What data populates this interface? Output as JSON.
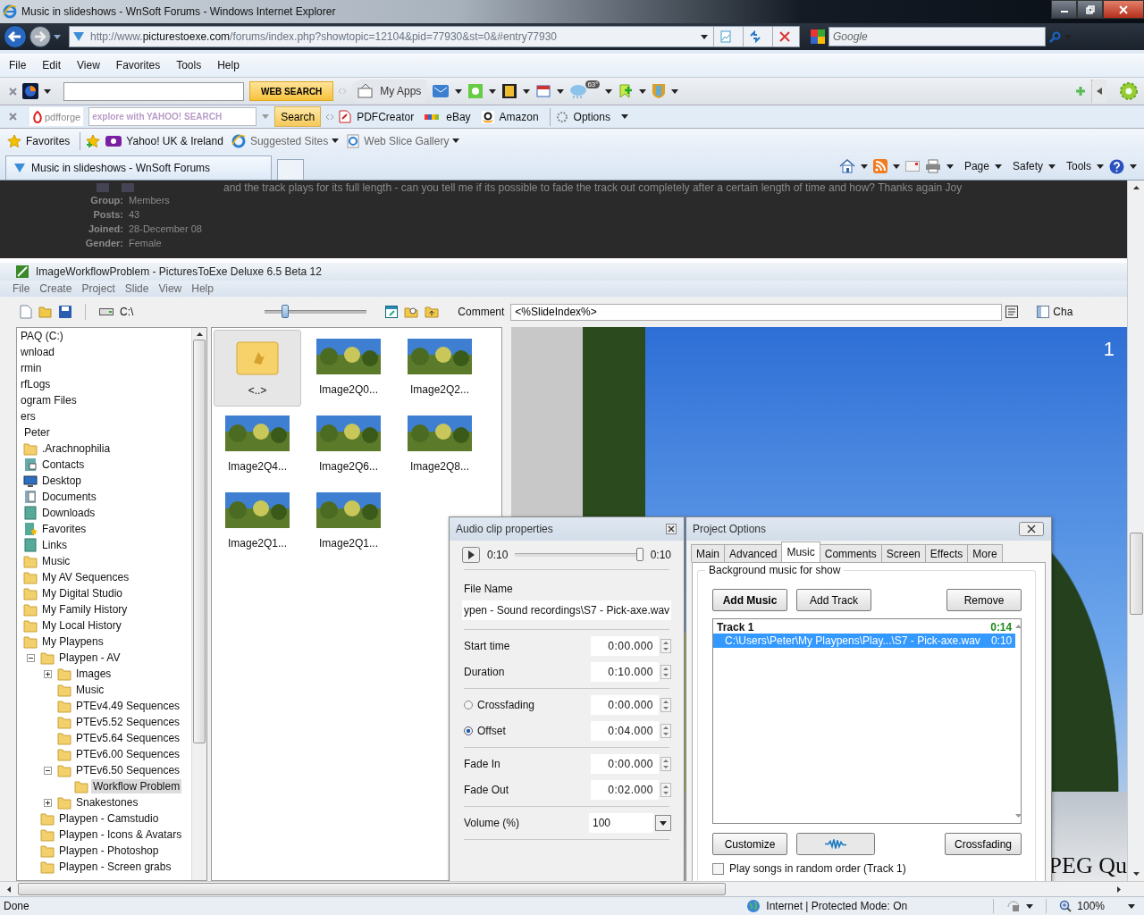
{
  "browser": {
    "title": "Music in slideshows - WnSoft Forums - Windows Internet Explorer",
    "address_host": "http://www.",
    "address_domain": "picturestoexe.com",
    "address_path": "/forums/index.php?showtopic=12104&pid=77930&st=0&#entry77930",
    "search_placeholder": "Google",
    "menu": [
      "File",
      "Edit",
      "View",
      "Favorites",
      "Tools",
      "Help"
    ],
    "toolbar": {
      "search_button": "WEB SEARCH",
      "apps_button": "My Apps",
      "weather_badge": "63°"
    },
    "toolbar2": {
      "brand": "pdfforge",
      "search_placeholder": "explore with YAHOO! SEARCH",
      "search_button": "Search",
      "links": [
        "PDFCreator",
        "eBay",
        "Amazon"
      ],
      "options": "Options"
    },
    "favorites": {
      "label": "Favorites",
      "links": [
        {
          "label": "Yahoo! UK & Ireland",
          "menu": false
        },
        {
          "label": "Suggested Sites",
          "menu": true
        },
        {
          "label": "Web Slice Gallery",
          "menu": true
        }
      ]
    },
    "tab": "Music in slideshows - WnSoft Forums",
    "commands": [
      "Page",
      "Safety",
      "Tools"
    ]
  },
  "forum": {
    "post_text": "and the track plays for its full length - can you tell me if its possible to fade the track out completely after a certain length of time and how? Thanks again Joy",
    "profile": [
      {
        "label": "Group:",
        "value": "Members"
      },
      {
        "label": "Posts:",
        "value": "43"
      },
      {
        "label": "Joined:",
        "value": "28-December 08"
      },
      {
        "label": "Gender:",
        "value": "Female"
      }
    ]
  },
  "app": {
    "title": "ImageWorkflowProblem - PicturesToExe Deluxe 6.5 Beta 12",
    "menu": [
      "File",
      "Create",
      "Project",
      "Slide",
      "View",
      "Help"
    ],
    "drive": "C:\\",
    "zoom_slider": {
      "level": 0.2
    },
    "comment_label": "Comment",
    "comment_value": "<%SlideIndex%>",
    "cut_label": "Cha",
    "tree": [
      {
        "label": "PAQ (C:)",
        "selected": false,
        "children": [
          {
            "label": "wnload",
            "selected": false
          },
          {
            "label": "rmin",
            "selected": false
          },
          {
            "label": "rfLogs",
            "selected": false
          },
          {
            "label": "ogram Files",
            "selected": false
          },
          {
            "label": "ers",
            "selected": false,
            "children": [
              {
                "label": "Peter",
                "selected": false,
                "children": [
                  {
                    "label": ".Arachnophilia",
                    "kind": "folder",
                    "selected": false
                  },
                  {
                    "label": "Contacts",
                    "kind": "contacts",
                    "selected": false
                  },
                  {
                    "label": "Desktop",
                    "kind": "desktop",
                    "selected": false
                  },
                  {
                    "label": "Documents",
                    "kind": "documents",
                    "selected": false
                  },
                  {
                    "label": "Downloads",
                    "kind": "special",
                    "selected": false
                  },
                  {
                    "label": "Favorites",
                    "kind": "favorites",
                    "selected": false
                  },
                  {
                    "label": "Links",
                    "kind": "special",
                    "selected": false
                  },
                  {
                    "label": "Music",
                    "kind": "folder",
                    "selected": false
                  },
                  {
                    "label": "My AV Sequences",
                    "kind": "folder",
                    "selected": false
                  },
                  {
                    "label": "My Digital Studio",
                    "kind": "folder",
                    "selected": false
                  },
                  {
                    "label": "My Family History",
                    "kind": "folder",
                    "selected": false
                  },
                  {
                    "label": "My Local History",
                    "kind": "folder",
                    "selected": false
                  },
                  {
                    "label": "My Playpens",
                    "kind": "folder",
                    "selected": false,
                    "children": [
                      {
                        "label": "Playpen - AV",
                        "kind": "folder",
                        "selected": false,
                        "expanded": true,
                        "children": [
                          {
                            "label": "Images",
                            "kind": "folder",
                            "selected": false,
                            "expanded": false
                          },
                          {
                            "label": "Music",
                            "kind": "folder",
                            "selected": false
                          },
                          {
                            "label": "PTEv4.49 Sequences",
                            "kind": "folder",
                            "selected": false
                          },
                          {
                            "label": "PTEv5.52 Sequences",
                            "kind": "folder",
                            "selected": false
                          },
                          {
                            "label": "PTEv5.64 Sequences",
                            "kind": "folder",
                            "selected": false
                          },
                          {
                            "label": "PTEv6.00 Sequences",
                            "kind": "folder",
                            "selected": false
                          },
                          {
                            "label": "PTEv6.50 Sequences",
                            "kind": "folder",
                            "selected": false,
                            "expanded": true,
                            "children": [
                              {
                                "label": "Workflow Problem",
                                "kind": "folder",
                                "selected": true
                              }
                            ]
                          },
                          {
                            "label": "Snakestones",
                            "kind": "folder",
                            "selected": false,
                            "expanded": false
                          }
                        ]
                      },
                      {
                        "label": "Playpen - Camstudio",
                        "kind": "folder",
                        "selected": false
                      },
                      {
                        "label": "Playpen - Icons & Avatars",
                        "kind": "folder",
                        "selected": false
                      },
                      {
                        "label": "Playpen - Photoshop",
                        "kind": "folder",
                        "selected": false
                      },
                      {
                        "label": "Playpen - Screen grabs",
                        "kind": "folder",
                        "selected": false
                      }
                    ]
                  }
                ]
              }
            ]
          }
        ]
      }
    ],
    "thumbnails": [
      {
        "label": "<..>",
        "kind": "folder",
        "selected": true
      },
      {
        "label": "Image2Q0...",
        "kind": "image",
        "selected": false
      },
      {
        "label": "Image2Q2...",
        "kind": "image",
        "selected": false
      },
      {
        "label": "Image2Q4...",
        "kind": "image",
        "selected": false
      },
      {
        "label": "Image2Q6...",
        "kind": "image",
        "selected": false
      },
      {
        "label": "Image2Q8...",
        "kind": "image",
        "selected": false
      },
      {
        "label": "Image2Q1...",
        "kind": "image",
        "selected": false
      },
      {
        "label": "Image2Q1...",
        "kind": "image",
        "selected": false
      }
    ],
    "slide_number": "1",
    "slide_caption": "PEG Qu"
  },
  "audio_clip": {
    "title": "Audio clip properties",
    "position": "0:10",
    "length": "0:10",
    "seek": {
      "level": 1
    },
    "file_label": "File Name",
    "file_value": "ypen - Sound recordings\\S7 - Pick-axe.wav",
    "groups": [
      [
        {
          "kind": "spin",
          "label": "Start time",
          "value": "0:00.000"
        },
        {
          "kind": "spin",
          "label": "Duration",
          "value": "0:10.000"
        }
      ],
      [
        {
          "kind": "radio",
          "label": "Crossfading",
          "value": "0:00.000",
          "selected": false
        },
        {
          "kind": "radio",
          "label": "Offset",
          "value": "0:04.000",
          "selected": true
        }
      ],
      [
        {
          "kind": "spin",
          "label": "Fade In",
          "value": "0:00.000"
        },
        {
          "kind": "spin",
          "label": "Fade Out",
          "value": "0:02.000"
        }
      ],
      [
        {
          "kind": "dropdown",
          "label": "Volume (%)",
          "value": "100"
        }
      ]
    ]
  },
  "project_options": {
    "title": "Project Options",
    "tabs": [
      {
        "label": "Main",
        "selected": false
      },
      {
        "label": "Advanced",
        "selected": false
      },
      {
        "label": "Music",
        "selected": true
      },
      {
        "label": "Comments",
        "selected": false
      },
      {
        "label": "Screen",
        "selected": false
      },
      {
        "label": "Effects",
        "selected": false
      },
      {
        "label": "More",
        "selected": false
      }
    ],
    "group_label": "Background music for show",
    "buttons": [
      {
        "label": "Add Music",
        "default": true
      },
      {
        "label": "Add Track",
        "default": false
      },
      {
        "label": "Remove",
        "default": false
      }
    ],
    "track": {
      "name": "Track 1",
      "duration": "0:14"
    },
    "items": [
      {
        "path": "C:\\Users\\Peter\\My Playpens\\Play...\\S7 - Pick-axe.wav",
        "duration": "0:10",
        "selected": true
      }
    ],
    "customize_button": "Customize",
    "crossfading_button": "Crossfading",
    "random_order": {
      "label": "Play songs in random order (Track 1)",
      "checked": false
    }
  },
  "status": {
    "text": "Done",
    "zone": "Internet | Protected Mode: On",
    "zoom": "100%"
  }
}
